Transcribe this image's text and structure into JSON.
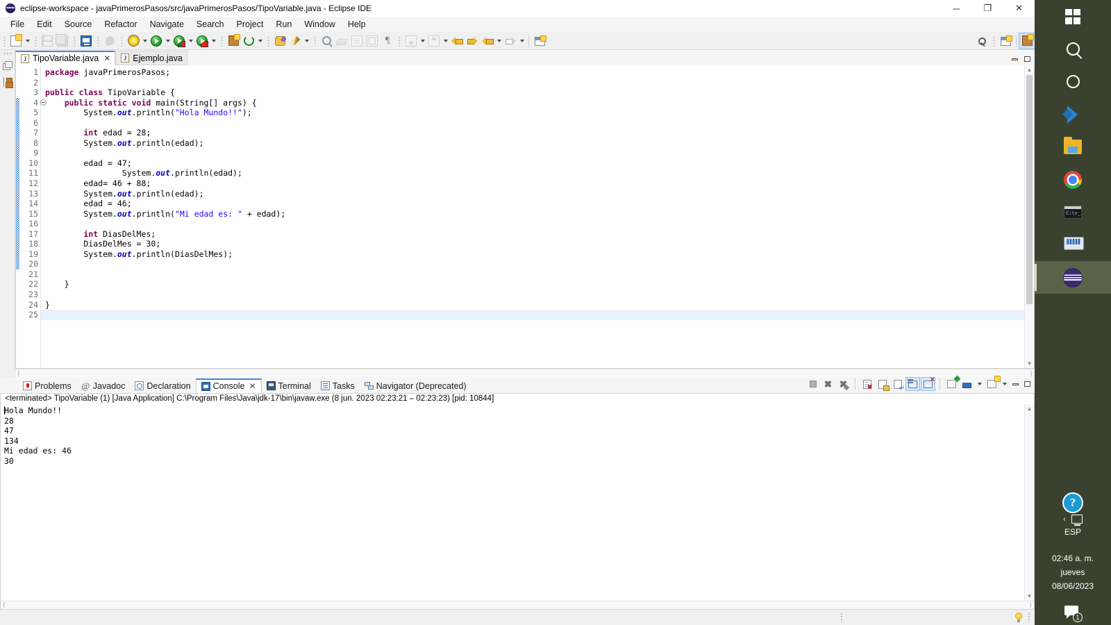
{
  "window": {
    "title": "eclipse-workspace - javaPrimerosPasos/src/javaPrimerosPasos/TipoVariable.java - Eclipse IDE",
    "app_icon": "eclipse-icon",
    "minimize": "─",
    "maximize": "❐",
    "close": "✕"
  },
  "menu": {
    "items": [
      {
        "label": "File"
      },
      {
        "label": "Edit"
      },
      {
        "label": "Source"
      },
      {
        "label": "Refactor"
      },
      {
        "label": "Navigate"
      },
      {
        "label": "Search"
      },
      {
        "label": "Project"
      },
      {
        "label": "Run"
      },
      {
        "label": "Window"
      },
      {
        "label": "Help"
      }
    ]
  },
  "toolbar": {
    "icons": [
      "new-wizard-icon",
      "save-icon",
      "save-all-icon",
      "print-console-icon",
      "link-icon",
      "debug-icon",
      "run-icon",
      "run-configuration-icon",
      "external-tools-icon",
      "new-java-class-icon",
      "refresh-icon",
      "open-resource-icon",
      "edit-pen-icon",
      "search-reference-icon",
      "erase-icon",
      "document-outline-icon",
      "block-selection-icon",
      "show-whitespace-icon",
      "next-annotation-icon",
      "previous-annotation-icon",
      "back-icon",
      "forward-icon",
      "last-edit-icon",
      "next-edit-icon",
      "search-icon",
      "open-perspective-icon"
    ]
  },
  "left_rail": {
    "items": [
      {
        "name": "package-explorer",
        "icon": "package-explorer-icon"
      },
      {
        "name": "outline",
        "icon": "outline-icon"
      }
    ]
  },
  "editor": {
    "tabs": [
      {
        "label": "TipoVariable.java",
        "active": true,
        "closable": true,
        "close_label": "✕"
      },
      {
        "label": "Ejemplo.java",
        "active": false,
        "closable": false,
        "close_label": ""
      }
    ],
    "minimize_tooltip": "Minimize",
    "maximize_tooltip": "Maximize",
    "current_line": 25,
    "fold_line": 4,
    "lines": [
      {
        "n": 1,
        "tokens": [
          {
            "t": "package",
            "c": "kw"
          },
          {
            "t": " javaPrimerosPasos;",
            "c": "pln"
          }
        ]
      },
      {
        "n": 2,
        "tokens": [
          {
            "t": "",
            "c": "pln"
          }
        ]
      },
      {
        "n": 3,
        "tokens": [
          {
            "t": "public class",
            "c": "kw"
          },
          {
            "t": " TipoVariable {",
            "c": "pln"
          }
        ]
      },
      {
        "n": 4,
        "tokens": [
          {
            "t": "    ",
            "c": "pln"
          },
          {
            "t": "public static void",
            "c": "kw"
          },
          {
            "t": " main(String[] args) {",
            "c": "pln"
          }
        ]
      },
      {
        "n": 5,
        "tokens": [
          {
            "t": "        System.",
            "c": "pln"
          },
          {
            "t": "out",
            "c": "fld"
          },
          {
            "t": ".println(",
            "c": "pln"
          },
          {
            "t": "\"Hola Mundo!!\"",
            "c": "str"
          },
          {
            "t": ");",
            "c": "pln"
          }
        ]
      },
      {
        "n": 6,
        "tokens": [
          {
            "t": "",
            "c": "pln"
          }
        ]
      },
      {
        "n": 7,
        "tokens": [
          {
            "t": "        ",
            "c": "pln"
          },
          {
            "t": "int",
            "c": "kw"
          },
          {
            "t": " edad = 28;",
            "c": "pln"
          }
        ]
      },
      {
        "n": 8,
        "tokens": [
          {
            "t": "        System.",
            "c": "pln"
          },
          {
            "t": "out",
            "c": "fld"
          },
          {
            "t": ".println(edad);",
            "c": "pln"
          }
        ]
      },
      {
        "n": 9,
        "tokens": [
          {
            "t": "",
            "c": "pln"
          }
        ]
      },
      {
        "n": 10,
        "tokens": [
          {
            "t": "        edad = 47;",
            "c": "pln"
          }
        ]
      },
      {
        "n": 11,
        "tokens": [
          {
            "t": "                System.",
            "c": "pln"
          },
          {
            "t": "out",
            "c": "fld"
          },
          {
            "t": ".println(edad);",
            "c": "pln"
          }
        ]
      },
      {
        "n": 12,
        "tokens": [
          {
            "t": "        edad= 46 + 88;",
            "c": "pln"
          }
        ]
      },
      {
        "n": 13,
        "tokens": [
          {
            "t": "        System.",
            "c": "pln"
          },
          {
            "t": "out",
            "c": "fld"
          },
          {
            "t": ".println(edad);",
            "c": "pln"
          }
        ]
      },
      {
        "n": 14,
        "tokens": [
          {
            "t": "        edad = 46;",
            "c": "pln"
          }
        ]
      },
      {
        "n": 15,
        "tokens": [
          {
            "t": "        System.",
            "c": "pln"
          },
          {
            "t": "out",
            "c": "fld"
          },
          {
            "t": ".println(",
            "c": "pln"
          },
          {
            "t": "\"Mi edad es: \"",
            "c": "str"
          },
          {
            "t": " + edad);",
            "c": "pln"
          }
        ]
      },
      {
        "n": 16,
        "tokens": [
          {
            "t": "",
            "c": "pln"
          }
        ]
      },
      {
        "n": 17,
        "tokens": [
          {
            "t": "        ",
            "c": "pln"
          },
          {
            "t": "int",
            "c": "kw"
          },
          {
            "t": " DiasDelMes;",
            "c": "pln"
          }
        ]
      },
      {
        "n": 18,
        "tokens": [
          {
            "t": "        DiasDelMes = 30;",
            "c": "pln"
          }
        ]
      },
      {
        "n": 19,
        "tokens": [
          {
            "t": "        System.",
            "c": "pln"
          },
          {
            "t": "out",
            "c": "fld"
          },
          {
            "t": ".println(DiasDelMes);",
            "c": "pln"
          }
        ]
      },
      {
        "n": 20,
        "tokens": [
          {
            "t": "",
            "c": "pln"
          }
        ]
      },
      {
        "n": 21,
        "tokens": [
          {
            "t": "",
            "c": "pln"
          }
        ]
      },
      {
        "n": 22,
        "tokens": [
          {
            "t": "    }",
            "c": "pln"
          }
        ]
      },
      {
        "n": 23,
        "tokens": [
          {
            "t": "",
            "c": "pln"
          }
        ]
      },
      {
        "n": 24,
        "tokens": [
          {
            "t": "}",
            "c": "pln"
          }
        ]
      },
      {
        "n": 25,
        "tokens": [
          {
            "t": "",
            "c": "pln"
          }
        ]
      }
    ]
  },
  "bottom_panel": {
    "tabs": [
      {
        "label": "Problems",
        "icon": "problems-icon",
        "active": false
      },
      {
        "label": "Javadoc",
        "icon": "javadoc-icon",
        "active": false
      },
      {
        "label": "Declaration",
        "icon": "declaration-icon",
        "active": false
      },
      {
        "label": "Console",
        "icon": "console-icon",
        "active": true,
        "close_label": "✕"
      },
      {
        "label": "Terminal",
        "icon": "terminal-icon",
        "active": false
      },
      {
        "label": "Tasks",
        "icon": "tasks-icon",
        "active": false
      },
      {
        "label": "Navigator (Deprecated)",
        "icon": "navigator-icon",
        "active": false
      }
    ],
    "toolbar_icons": [
      "terminate-icon",
      "terminate-all-icon",
      "remove-all-terminated-icon",
      "clear-console-icon",
      "scroll-lock-icon",
      "word-wrap-icon",
      "show-console-on-output-icon",
      "show-console-on-error-icon",
      "pin-console-icon",
      "display-selected-console-icon",
      "open-console-icon",
      "minimize-icon",
      "maximize-icon"
    ],
    "console": {
      "header": "<terminated> TipoVariable (1) [Java Application] C:\\Program Files\\Java\\jdk-17\\bin\\javaw.exe  (8 jun. 2023 02:23:21 – 02:23:23) [pid: 10844]",
      "output": [
        "Hola Mundo!!",
        "28",
        "47",
        "134",
        "Mi edad es: 46",
        "30"
      ]
    }
  },
  "status_bar": {
    "tip_icon": "lightbulb-icon"
  },
  "taskbar": {
    "items": [
      {
        "name": "start-button",
        "icon": "windows-logo-icon",
        "active": false
      },
      {
        "name": "search",
        "icon": "search-icon",
        "active": false
      },
      {
        "name": "cortana",
        "icon": "cortana-circle-icon",
        "active": false
      },
      {
        "name": "vs-code",
        "icon": "vscode-icon",
        "active": false
      },
      {
        "name": "file-explorer",
        "icon": "file-explorer-icon",
        "active": false
      },
      {
        "name": "google-chrome",
        "icon": "chrome-icon",
        "active": false
      },
      {
        "name": "command-prompt",
        "icon": "terminal-icon",
        "active": false
      },
      {
        "name": "remote-desktop",
        "icon": "remote-desktop-icon",
        "active": false
      },
      {
        "name": "eclipse-ide",
        "icon": "eclipse-icon",
        "active": true
      }
    ],
    "tray": {
      "help_label": "?",
      "chevron": "‹",
      "network_icon": "network-icon",
      "language": "ESP",
      "time": "02:46 a. m.",
      "weekday": "jueves",
      "date": "08/06/2023",
      "notification_icon": "notification-icon",
      "notification_count": "1"
    }
  }
}
